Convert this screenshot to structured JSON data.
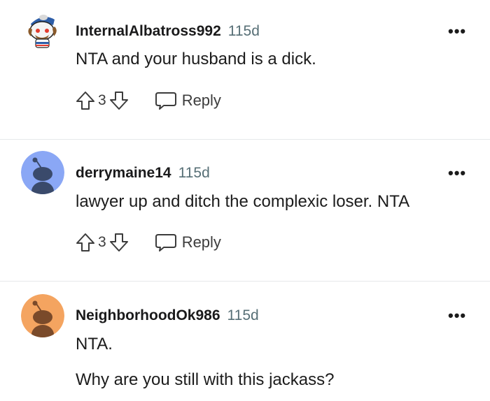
{
  "comments": [
    {
      "username": "InternalAlbatross992",
      "age": "115d",
      "menu": "•••",
      "body": [
        "NTA and your husband is a dick."
      ],
      "score": "3",
      "reply_label": "Reply",
      "avatar_color": "#e8eef4"
    },
    {
      "username": "derrymaine14",
      "age": "115d",
      "menu": "•••",
      "body": [
        "lawyer up and ditch the complexic loser. NTA"
      ],
      "score": "3",
      "reply_label": "Reply",
      "avatar_color": "#8aa7f5"
    },
    {
      "username": "NeighborhoodOk986",
      "age": "115d",
      "menu": "•••",
      "body": [
        "NTA.",
        "Why are you still with this jackass?"
      ],
      "avatar_color": "#f4a460"
    }
  ]
}
